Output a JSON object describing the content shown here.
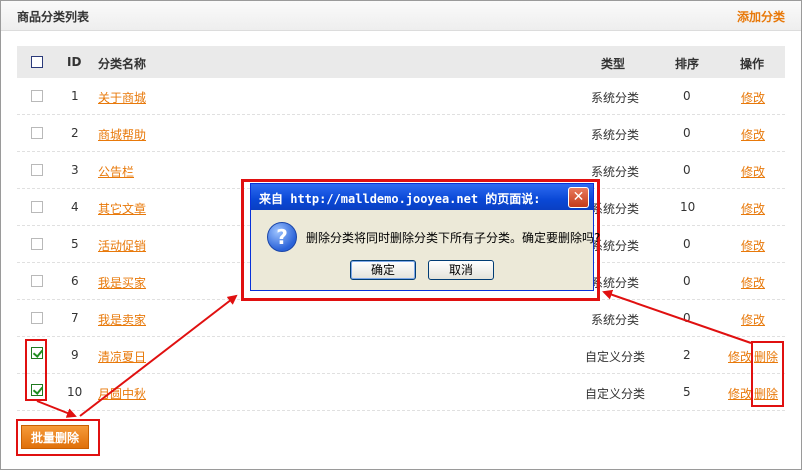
{
  "header": {
    "title": "商品分类列表",
    "add_link": "添加分类"
  },
  "table": {
    "columns": {
      "id": "ID",
      "name": "分类名称",
      "type": "类型",
      "sort": "排序",
      "action": "操作"
    },
    "rows": [
      {
        "id": "1",
        "name": "关于商城",
        "type": "系统分类",
        "sort": "0",
        "edit": "修改",
        "delete": "",
        "checked": false
      },
      {
        "id": "2",
        "name": "商城帮助",
        "type": "系统分类",
        "sort": "0",
        "edit": "修改",
        "delete": "",
        "checked": false
      },
      {
        "id": "3",
        "name": "公告栏",
        "type": "系统分类",
        "sort": "0",
        "edit": "修改",
        "delete": "",
        "checked": false
      },
      {
        "id": "4",
        "name": "其它文章",
        "type": "系统分类",
        "sort": "10",
        "edit": "修改",
        "delete": "",
        "checked": false
      },
      {
        "id": "5",
        "name": "活动促销",
        "type": "系统分类",
        "sort": "0",
        "edit": "修改",
        "delete": "",
        "checked": false
      },
      {
        "id": "6",
        "name": "我是买家",
        "type": "系统分类",
        "sort": "0",
        "edit": "修改",
        "delete": "",
        "checked": false
      },
      {
        "id": "7",
        "name": "我是卖家",
        "type": "系统分类",
        "sort": "0",
        "edit": "修改",
        "delete": "",
        "checked": false
      },
      {
        "id": "9",
        "name": "清凉夏日",
        "type": "自定义分类",
        "sort": "2",
        "edit": "修改",
        "delete": "删除",
        "checked": true
      },
      {
        "id": "10",
        "name": "月圆中秋",
        "type": "自定义分类",
        "sort": "5",
        "edit": "修改",
        "delete": "删除",
        "checked": true
      }
    ]
  },
  "batch_delete": "批量删除",
  "dialog": {
    "title": "来自 http://malldemo.jooyea.net 的页面说:",
    "close": "✕",
    "icon": "?",
    "icon_name": "question-icon",
    "message": "删除分类将同时删除分类下所有子分类。确定要删除吗?",
    "ok": "确定",
    "cancel": "取消"
  },
  "colors": {
    "accent": "#e8790a",
    "annotation": "#e01010",
    "dialog_title": "#0a48d6"
  }
}
